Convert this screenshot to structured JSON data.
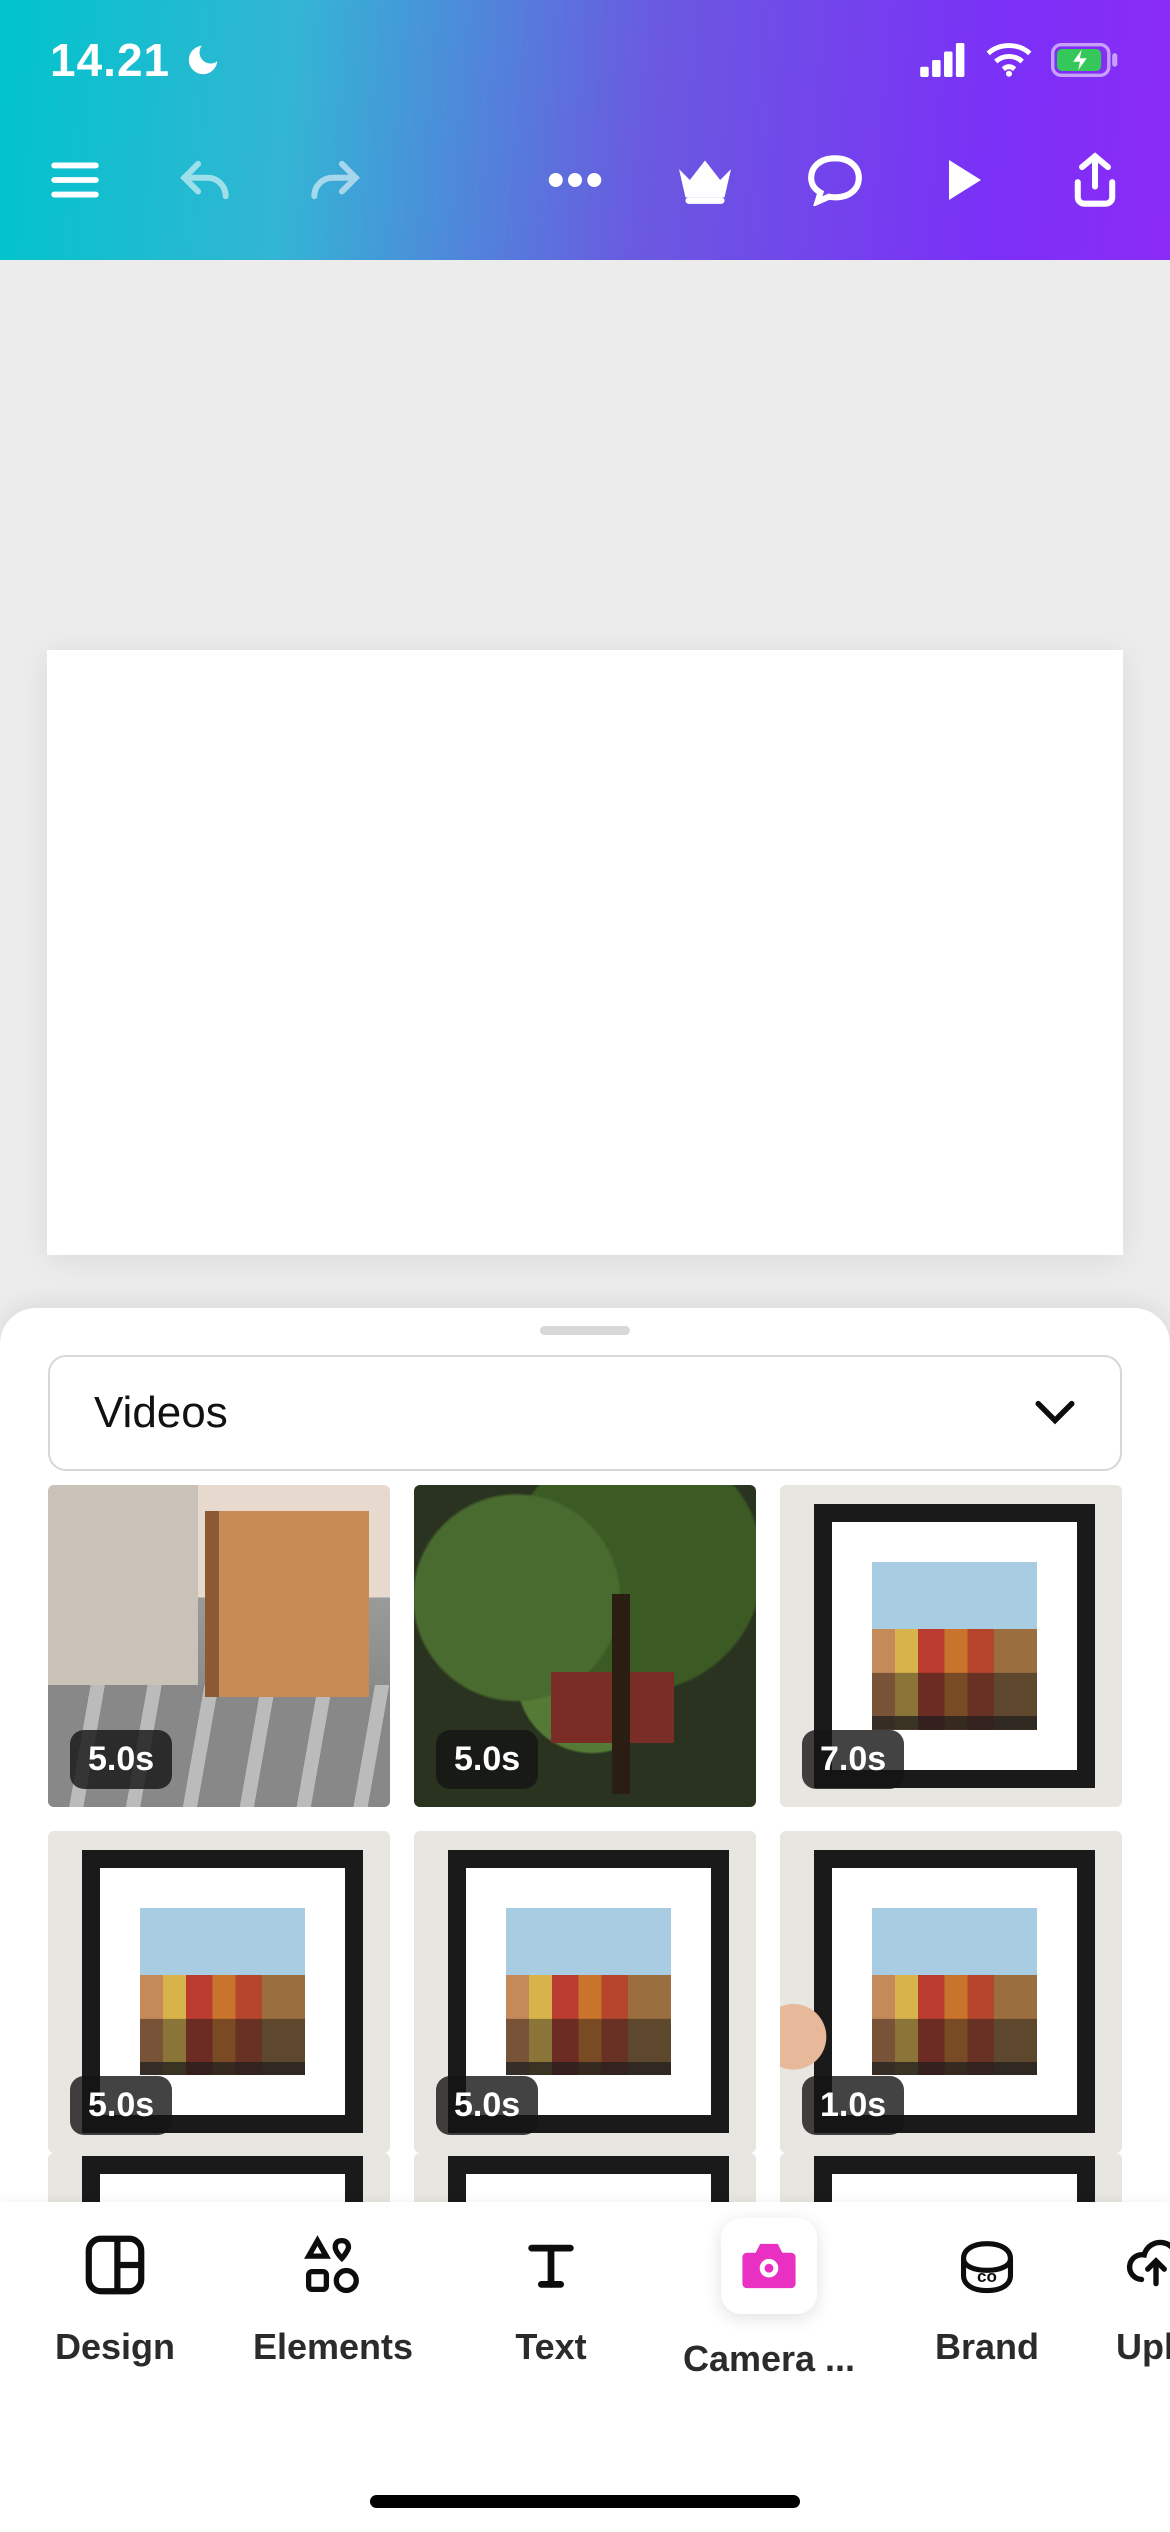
{
  "status": {
    "time": "14.21"
  },
  "panel": {
    "dropdown_label": "Videos"
  },
  "videos": {
    "row1": [
      {
        "duration": "5.0s",
        "thumb": "street"
      },
      {
        "duration": "5.0s",
        "thumb": "trees"
      },
      {
        "duration": "7.0s",
        "thumb": "frame"
      }
    ],
    "row2": [
      {
        "duration": "5.0s",
        "thumb": "frame"
      },
      {
        "duration": "5.0s",
        "thumb": "frame"
      },
      {
        "duration": "1.0s",
        "thumb": "frame-hand"
      }
    ]
  },
  "tabs": {
    "design": "Design",
    "elements": "Elements",
    "text": "Text",
    "camera": "Camera ...",
    "brand": "Brand",
    "uploads": "Uplo"
  }
}
